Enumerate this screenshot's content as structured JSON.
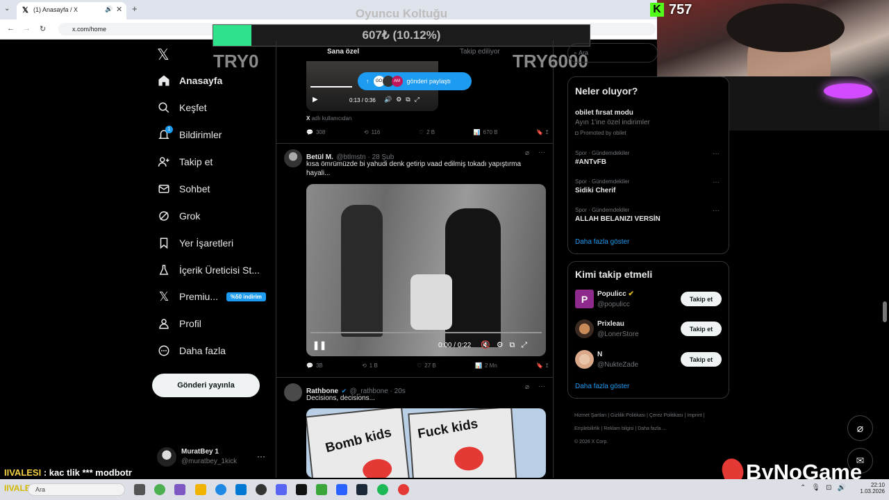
{
  "browser": {
    "tab_title": "(1) Anasayfa / X",
    "url": "x.com/home"
  },
  "overlay": {
    "title": "Oyuncu Koltuğu",
    "progress_text": "607₺ (10.12%)",
    "progress_fraction": 0.1012,
    "left_label": "TRY0",
    "right_label": "TRY6000",
    "viewer_count": "757",
    "chat_message_user": "IIVALESI",
    "chat_message_text": " : kac tlik *** modbotr",
    "brand": "ByNoGame",
    "colors": {
      "progress": "#2fe38c",
      "kick": "#53fc18"
    }
  },
  "sidebar": {
    "items": [
      {
        "label": "Anasayfa",
        "icon": "home-icon",
        "active": true
      },
      {
        "label": "Keşfet",
        "icon": "search-icon"
      },
      {
        "label": "Bildirimler",
        "icon": "bell-icon",
        "badge": "1"
      },
      {
        "label": "Takip et",
        "icon": "person-plus-icon"
      },
      {
        "label": "Sohbet",
        "icon": "mail-icon"
      },
      {
        "label": "Grok",
        "icon": "grok-icon"
      },
      {
        "label": "Yer İşaretleri",
        "icon": "bookmark-icon"
      },
      {
        "label": "İçerik Üreticisi St...",
        "icon": "creator-icon"
      },
      {
        "label": "Premiu...",
        "icon": "x-logo-icon",
        "badge": "%50 indirim"
      },
      {
        "label": "Profil",
        "icon": "person-icon"
      },
      {
        "label": "Daha fazla",
        "icon": "more-circle-icon"
      }
    ],
    "post_button": "Gönderi yayınla",
    "account": {
      "name": "MuratBey 1",
      "handle": "@muratbey_1kick"
    }
  },
  "feed": {
    "tabs": [
      "Sana özel",
      "Takip ediliyor"
    ],
    "share_pill": "gönderi paylaştı",
    "top_tweet": {
      "video_time": "0:13 / 0:36",
      "source_prefix": "X",
      "source_text": " adlı kullanıcıdan",
      "replies": "308",
      "reposts": "116",
      "likes": "2 B",
      "views": "670 B"
    },
    "tweet2": {
      "author": "Betül M.",
      "handle": "@btlmstn · 28 Şub",
      "text": "kısa ömrümüzde bi yahudi denk getirip vaad edilmiş tokadı yapıştırma hayali...",
      "video_time": "0:00 / 0:22",
      "replies": "3B",
      "reposts": "1 B",
      "likes": "27 B",
      "views": "2 Mn"
    },
    "tweet3": {
      "author": "Rathbone",
      "handle": "@_rathbone · 20s",
      "text": "Decisions, decisions...",
      "meme_left": "Bomb kids",
      "meme_right": "Fuck kids"
    }
  },
  "right": {
    "search_placeholder": "Ara",
    "trends_title": "Neler oluyor?",
    "promo": {
      "name": "obilet fırsat modu",
      "desc": "Ayın 1'ine özel indirimler",
      "promoted": "Promoted by obilet"
    },
    "trends": [
      {
        "meta": "Spor · Gündemdekiler",
        "name": "#ANTvFB"
      },
      {
        "meta": "Spor · Gündemdekiler",
        "name": "Sidiki Cherif"
      },
      {
        "meta": "Spor · Gündemdekiler",
        "name": "ALLAH BELANIZI VERSİN"
      }
    ],
    "trends_more": "Daha fazla göster",
    "follow_title": "Kimi takip etmeli",
    "suggestions": [
      {
        "name": "Populicc",
        "handle": "@populicc",
        "button": "Takip et"
      },
      {
        "name": "Prixleau",
        "handle": "@LonerStore",
        "button": "Takip et"
      },
      {
        "name": "N",
        "handle": "@NukteZade",
        "button": "Takip et"
      }
    ],
    "follow_more": "Daha fazla göster",
    "footer": [
      "Hizmet Şartları",
      "Gizlilik Politikası",
      "Çerez Politikası",
      "Imprint",
      "Erişilebilirlik",
      "Reklam bilgisi",
      "Daha fazla ...",
      "© 2026 X Corp."
    ]
  },
  "taskbar": {
    "time": "22:10",
    "date": "1.03.2026",
    "search_text": "Ara",
    "chat_overlay": "IIVALESI : celm"
  }
}
